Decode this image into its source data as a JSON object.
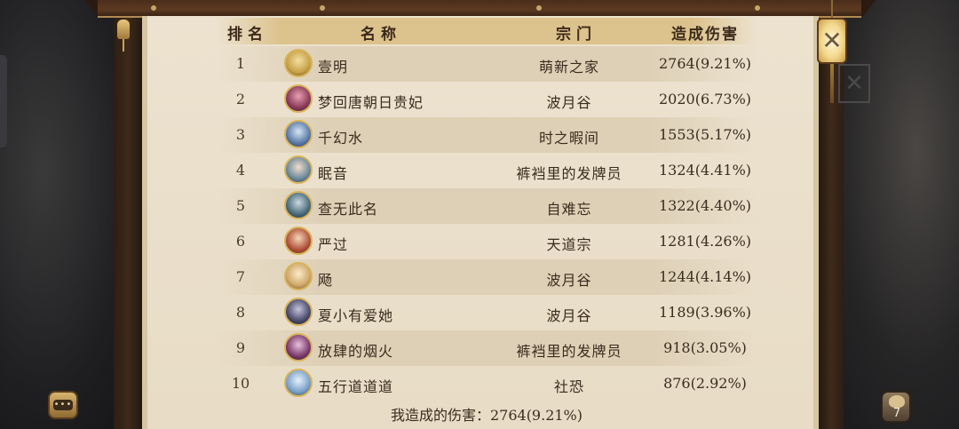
{
  "table": {
    "headers": {
      "rank": "排名",
      "name": "名称",
      "sect": "宗门",
      "damage": "造成伤害"
    },
    "rows": [
      {
        "rank": "1",
        "name": "壹明",
        "sect": "萌新之家",
        "damage": "2764(9.21%)",
        "avatar_color": "#c9a24a"
      },
      {
        "rank": "2",
        "name": "梦回唐朝日贵妃",
        "sect": "波月谷",
        "damage": "2020(6.73%)",
        "avatar_color": "#8a3a5a"
      },
      {
        "rank": "3",
        "name": "千幻水",
        "sect": "时之暇间",
        "damage": "1553(5.17%)",
        "avatar_color": "#5a7aa8"
      },
      {
        "rank": "4",
        "name": "眠音",
        "sect": "裤裆里的发牌员",
        "damage": "1324(4.41%)",
        "avatar_color": "#6b8a9a"
      },
      {
        "rank": "5",
        "name": "查无此名",
        "sect": "自难忘",
        "damage": "1322(4.40%)",
        "avatar_color": "#4a6a7a"
      },
      {
        "rank": "6",
        "name": "严过",
        "sect": "天道宗",
        "damage": "1281(4.26%)",
        "avatar_color": "#b0523a"
      },
      {
        "rank": "7",
        "name": "飏",
        "sect": "波月谷",
        "damage": "1244(4.14%)",
        "avatar_color": "#d0a86a"
      },
      {
        "rank": "8",
        "name": "夏小有爱她",
        "sect": "波月谷",
        "damage": "1189(3.96%)",
        "avatar_color": "#4a4a6a"
      },
      {
        "rank": "9",
        "name": "放肆的烟火",
        "sect": "裤裆里的发牌员",
        "damage": "918(3.05%)",
        "avatar_color": "#7a3a6a"
      },
      {
        "rank": "10",
        "name": "五行道道道",
        "sect": "社恐",
        "damage": "876(2.92%)",
        "avatar_color": "#7aa0c8"
      }
    ]
  },
  "footer": {
    "my_damage": "我造成的伤害：2764(9.21%)"
  },
  "controls": {
    "close_symbol": "✕",
    "chat_symbol": "•••",
    "gift_count": "7"
  },
  "colors": {
    "parchment": "#ece2cf",
    "header_band": "#dcc28c",
    "text": "#3a2c1e",
    "wood": "#4a2d1a"
  }
}
